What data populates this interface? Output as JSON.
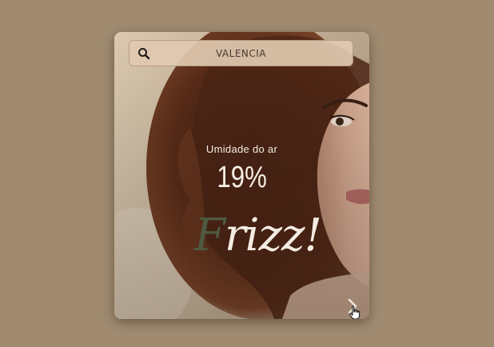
{
  "search": {
    "value": "VALENCIA",
    "placeholder": "VALENCIA",
    "icon": "search-icon"
  },
  "weather": {
    "label": "Umidade do ar",
    "value": "19%"
  },
  "status": {
    "first_letter": "F",
    "rest": "rizz!"
  },
  "navigation": {
    "next_icon": "chevron-right-icon"
  },
  "colors": {
    "page_background": "#a08b70",
    "frizz_accent": "#4e5a3f",
    "text_light": "#f4ece2",
    "search_background": "#e0c9b0"
  }
}
